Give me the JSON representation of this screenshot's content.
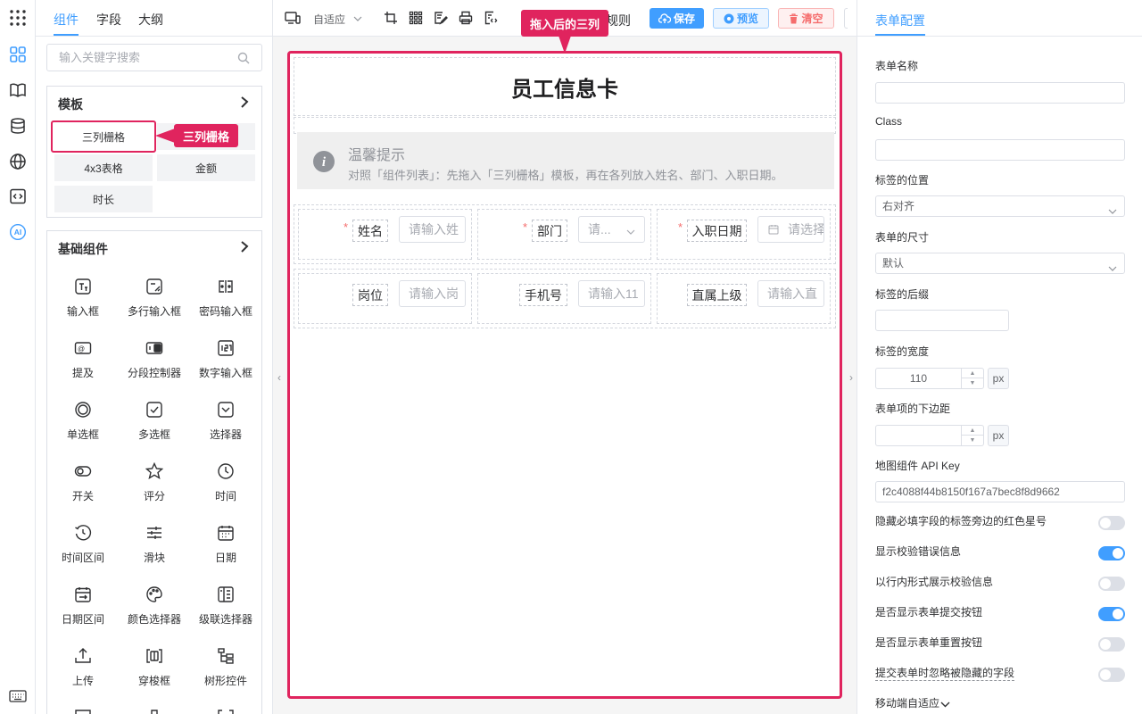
{
  "left_tabs": {
    "components": "组件",
    "fields": "字段",
    "outline": "大纲"
  },
  "search": {
    "placeholder": "输入关键字搜索"
  },
  "templates": {
    "title": "模板",
    "items": [
      "三列栅格",
      "4x3表格",
      "金额",
      "时长"
    ],
    "highlighted": "三列栅格"
  },
  "callouts": {
    "template": "三列栅格",
    "canvas": "拖入后的三列"
  },
  "basic": {
    "title": "基础组件",
    "items": [
      {
        "label": "输入框",
        "icon": "text-input-icon"
      },
      {
        "label": "多行输入框",
        "icon": "textarea-icon"
      },
      {
        "label": "密码输入框",
        "icon": "password-input-icon"
      },
      {
        "label": "提及",
        "icon": "mention-icon"
      },
      {
        "label": "分段控制器",
        "icon": "segmented-control-icon"
      },
      {
        "label": "数字输入框",
        "icon": "number-input-icon"
      },
      {
        "label": "单选框",
        "icon": "radio-icon"
      },
      {
        "label": "多选框",
        "icon": "checkbox-icon"
      },
      {
        "label": "选择器",
        "icon": "select-icon"
      },
      {
        "label": "开关",
        "icon": "switch-icon"
      },
      {
        "label": "评分",
        "icon": "star-icon"
      },
      {
        "label": "时间",
        "icon": "clock-icon"
      },
      {
        "label": "时间区间",
        "icon": "time-range-icon"
      },
      {
        "label": "滑块",
        "icon": "slider-icon"
      },
      {
        "label": "日期",
        "icon": "calendar-icon"
      },
      {
        "label": "日期区间",
        "icon": "date-range-icon"
      },
      {
        "label": "颜色选择器",
        "icon": "palette-icon"
      },
      {
        "label": "级联选择器",
        "icon": "cascader-icon"
      },
      {
        "label": "上传",
        "icon": "upload-icon"
      },
      {
        "label": "穿梭框",
        "icon": "transfer-icon"
      },
      {
        "label": "树形控件",
        "icon": "tree-icon"
      }
    ]
  },
  "toolbar": {
    "layout_mode": "自适应",
    "rules_label": "规则",
    "save": "保存",
    "preview": "预览",
    "clear": "清空"
  },
  "form": {
    "title": "员工信息卡",
    "alert_title": "温馨提示",
    "alert_text": "对照「组件列表」：先拖入「三列栅格」模板，再在各列放入姓名、部门、入职日期。",
    "row1": [
      {
        "label": "姓名",
        "placeholder": "请输入姓",
        "required": "*"
      },
      {
        "label": "部门",
        "placeholder": "请...",
        "required": "*"
      },
      {
        "label": "入职日期",
        "placeholder": "请选择",
        "required": "*"
      }
    ],
    "row2": [
      {
        "label": "岗位",
        "placeholder": "请输入岗"
      },
      {
        "label": "手机号",
        "placeholder": "请输入11"
      },
      {
        "label": "直属上级",
        "placeholder": "请输入直"
      }
    ]
  },
  "config": {
    "tab": "表单配置",
    "form_name_label": "表单名称",
    "form_name_value": "",
    "class_label": "Class",
    "class_value": "",
    "label_position_label": "标签的位置",
    "label_position_value": "右对齐",
    "size_label": "表单的尺寸",
    "size_value": "默认",
    "suffix_label": "标签的后缀",
    "suffix_value": "",
    "label_width_label": "标签的宽度",
    "label_width_value": "110",
    "unit": "px",
    "margin_label": "表单项的下边距",
    "margin_value": "",
    "api_key_label": "地图组件 API Key",
    "api_key_value": "f2c4088f44b8150f167a7bec8f8d9662",
    "toggles": [
      {
        "label": "隐藏必填字段的标签旁边的红色星号",
        "on": false
      },
      {
        "label": "显示校验错误信息",
        "on": true
      },
      {
        "label": "以行内形式展示校验信息",
        "on": false
      },
      {
        "label": "是否显示表单提交按钮",
        "on": true
      },
      {
        "label": "是否显示表单重置按钮",
        "on": false
      },
      {
        "label": "提交表单时忽略被隐藏的字段",
        "on": false
      }
    ],
    "mobile_label": "移动端自适应"
  },
  "colors": {
    "accent": "#409eff",
    "highlight": "#e0245e",
    "required": "#f56c6c"
  }
}
